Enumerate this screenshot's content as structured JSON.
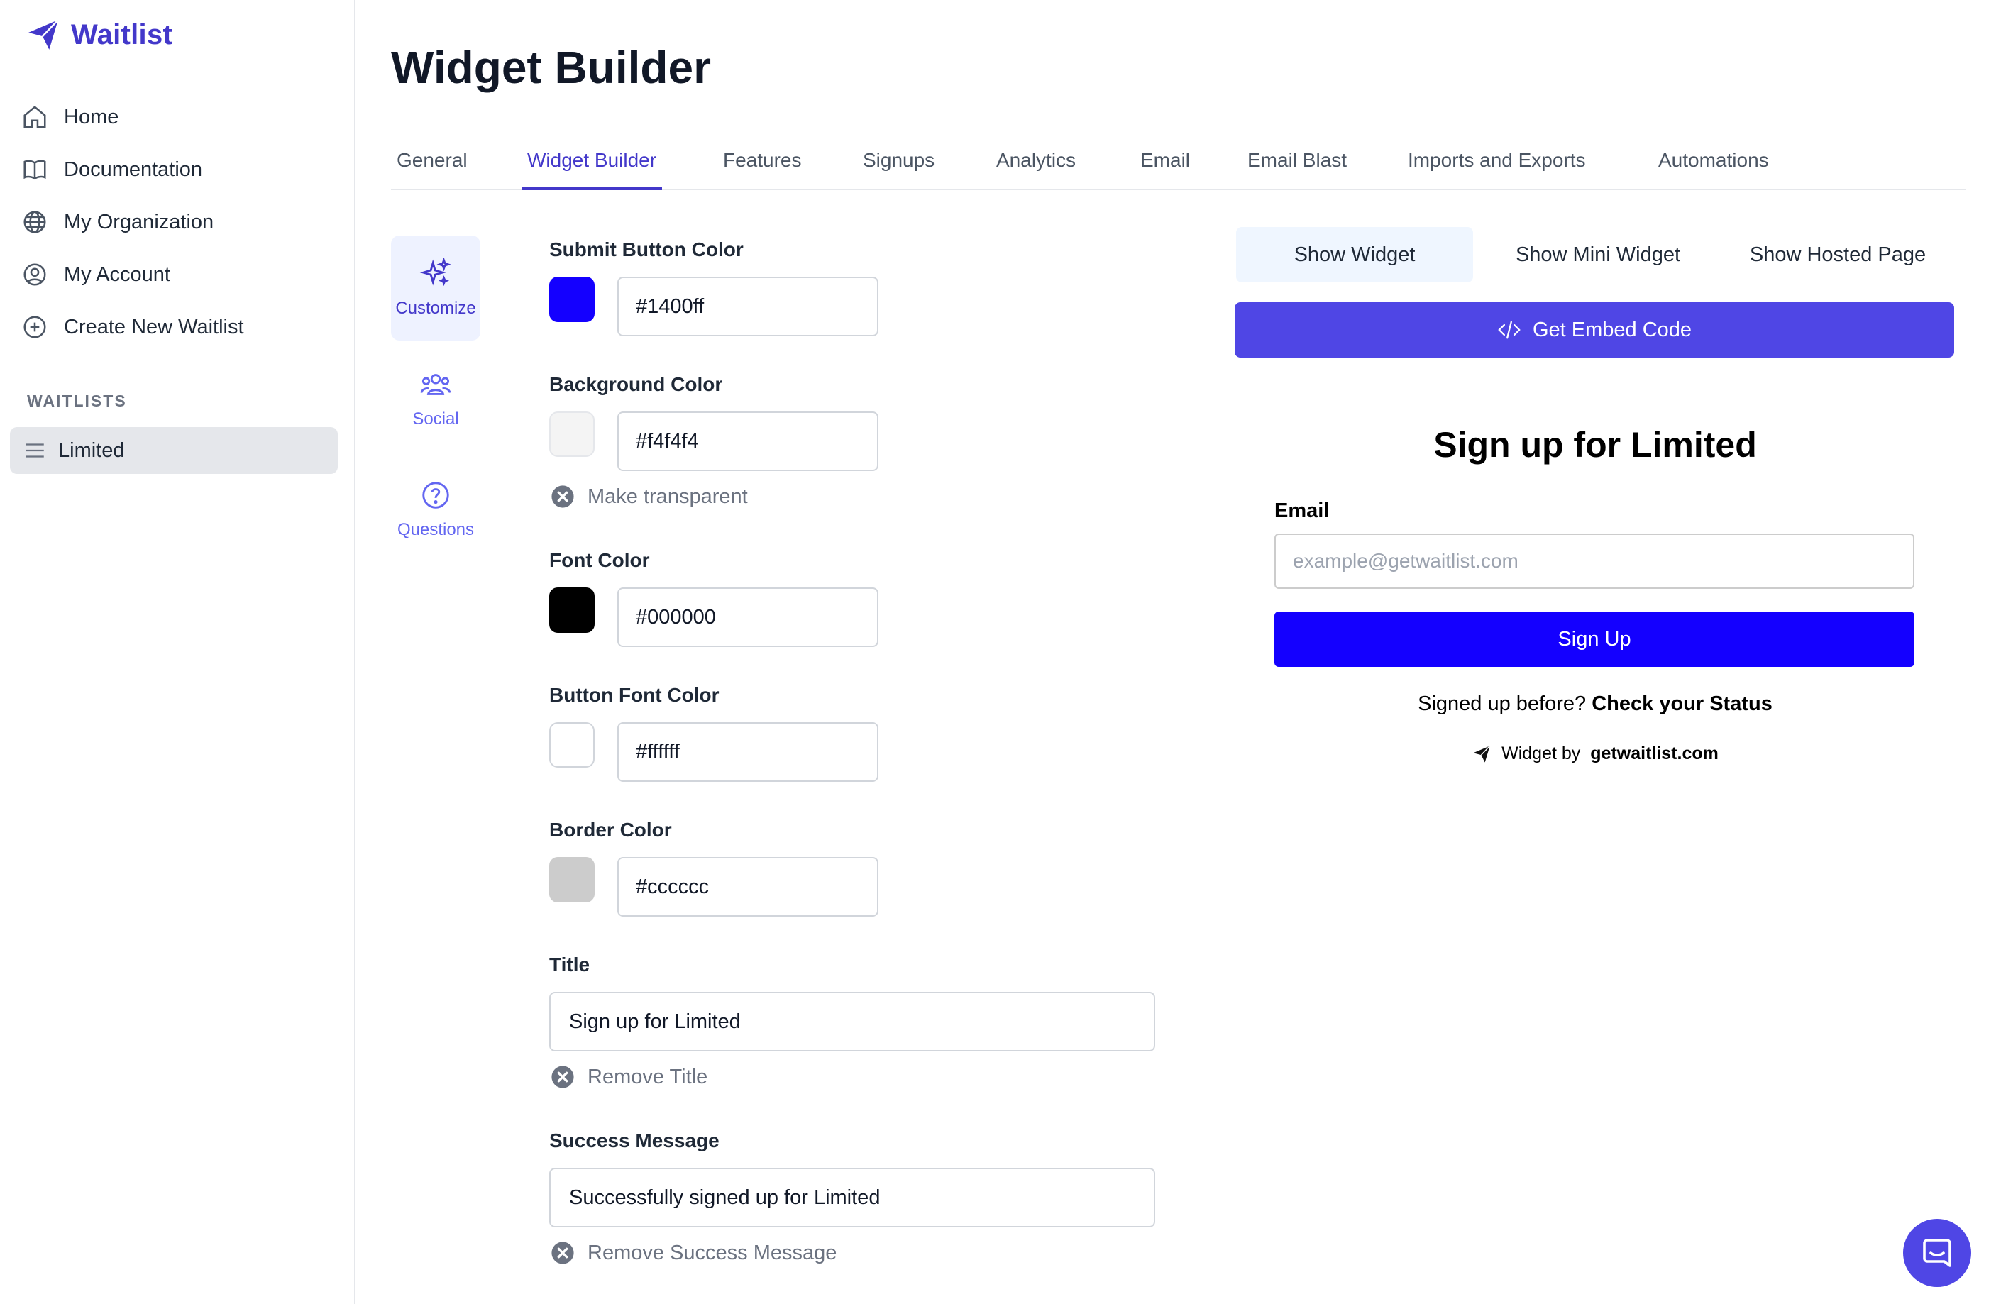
{
  "brand": {
    "name": "Waitlist"
  },
  "sidebar": {
    "items": [
      {
        "label": "Home",
        "icon": "home-icon"
      },
      {
        "label": "Documentation",
        "icon": "book-icon"
      },
      {
        "label": "My Organization",
        "icon": "globe-icon"
      },
      {
        "label": "My Account",
        "icon": "user-circle-icon"
      },
      {
        "label": "Create New Waitlist",
        "icon": "plus-circle-icon"
      }
    ],
    "section_label": "WAITLISTS",
    "waitlists": [
      {
        "label": "Limited",
        "icon": "menu-lines-icon"
      }
    ]
  },
  "page": {
    "title": "Widget Builder"
  },
  "tabs": [
    {
      "label": "General"
    },
    {
      "label": "Widget Builder",
      "active": true
    },
    {
      "label": "Features"
    },
    {
      "label": "Signups"
    },
    {
      "label": "Analytics"
    },
    {
      "label": "Email"
    },
    {
      "label": "Email Blast"
    },
    {
      "label": "Imports and Exports"
    },
    {
      "label": "Automations"
    }
  ],
  "subnav": [
    {
      "label": "Customize",
      "icon": "sparkles-icon",
      "active": true
    },
    {
      "label": "Social",
      "icon": "users-group-icon"
    },
    {
      "label": "Questions",
      "icon": "question-circle-icon"
    }
  ],
  "form": {
    "submit_button_color": {
      "label": "Submit Button Color",
      "value": "#1400ff"
    },
    "background_color": {
      "label": "Background Color",
      "value": "#f4f4f4",
      "toggle": "Make transparent"
    },
    "font_color": {
      "label": "Font Color",
      "value": "#000000"
    },
    "button_font_color": {
      "label": "Button Font Color",
      "value": "#ffffff"
    },
    "border_color": {
      "label": "Border Color",
      "value": "#cccccc"
    },
    "title": {
      "label": "Title",
      "value": "Sign up for Limited",
      "toggle": "Remove Title"
    },
    "success_message": {
      "label": "Success Message",
      "value": "Successfully signed up for Limited",
      "toggle": "Remove Success Message"
    }
  },
  "preview": {
    "tabs": [
      {
        "label": "Show Widget",
        "active": true
      },
      {
        "label": "Show Mini Widget"
      },
      {
        "label": "Show Hosted Page"
      }
    ],
    "embed_button": "Get Embed Code",
    "widget": {
      "title": "Sign up for Limited",
      "email_label": "Email",
      "email_placeholder": "example@getwaitlist.com",
      "submit_label": "Sign Up",
      "status_prefix": "Signed up before?",
      "status_link": "Check your Status",
      "credit_prefix": "Widget by",
      "credit_site": "getwaitlist.com"
    }
  },
  "colors": {
    "accent": "#4338ca",
    "embed": "#4f46e5"
  }
}
